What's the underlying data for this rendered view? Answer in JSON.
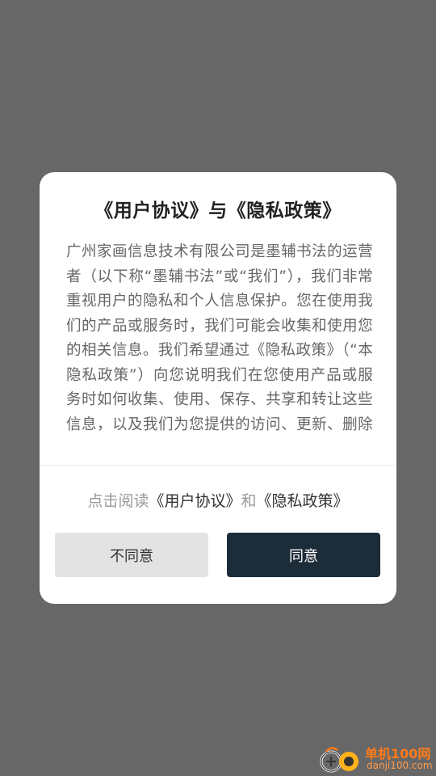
{
  "dialog": {
    "title": "《用户协议》与《隐私政策》",
    "body": "广州家画信息技术有限公司是墨辅书法的运营者（以下称“墨辅书法”或“我们”），我们非常重视用户的隐私和个人信息保护。您在使用我们的产品或服务时，我们可能会收集和使用您的相关信息。我们希望通过《隐私政策》（“本隐私政策”）向您说明我们在您使用产品或服务时如何收集、使用、保存、共享和转让这些信息，以及我们为您提供的访问、更新、删除和保护这些信息的方式。",
    "agreement": {
      "prefix": "点击阅读",
      "user_agreement": "《用户协议》",
      "and": "和",
      "privacy_policy": "《隐私政策》"
    },
    "buttons": {
      "disagree": "不同意",
      "agree": "同意"
    }
  },
  "watermark": {
    "title": "单机100网",
    "subtitle": "danji100.com"
  },
  "colors": {
    "overlay": "#676767",
    "agree_button": "#1d2c39",
    "disagree_button": "#e3e3e3",
    "watermark": "#ff7a1a"
  }
}
